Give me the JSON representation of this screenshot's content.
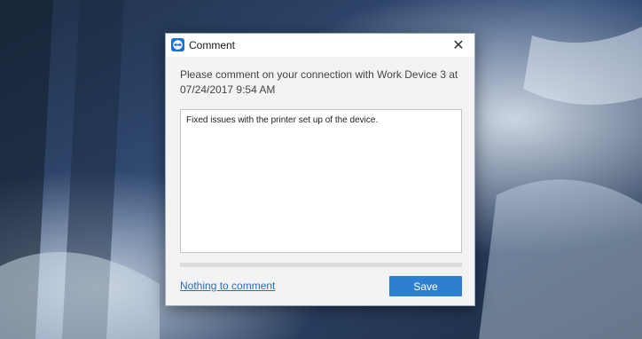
{
  "dialog": {
    "title": "Comment",
    "message": "Please comment on your connection with Work Device 3 at 07/24/2017 9:54 AM",
    "comment_value": "Fixed issues with the printer set up of the device.",
    "nothing_link": "Nothing to comment",
    "save_label": "Save",
    "close_glyph": "✕"
  },
  "icons": {
    "app": "teamviewer-logo-icon",
    "close": "close-icon"
  },
  "colors": {
    "accent": "#2f7fd0",
    "link": "#2a6fb6",
    "app_icon_bg": "#1d6fd6"
  }
}
